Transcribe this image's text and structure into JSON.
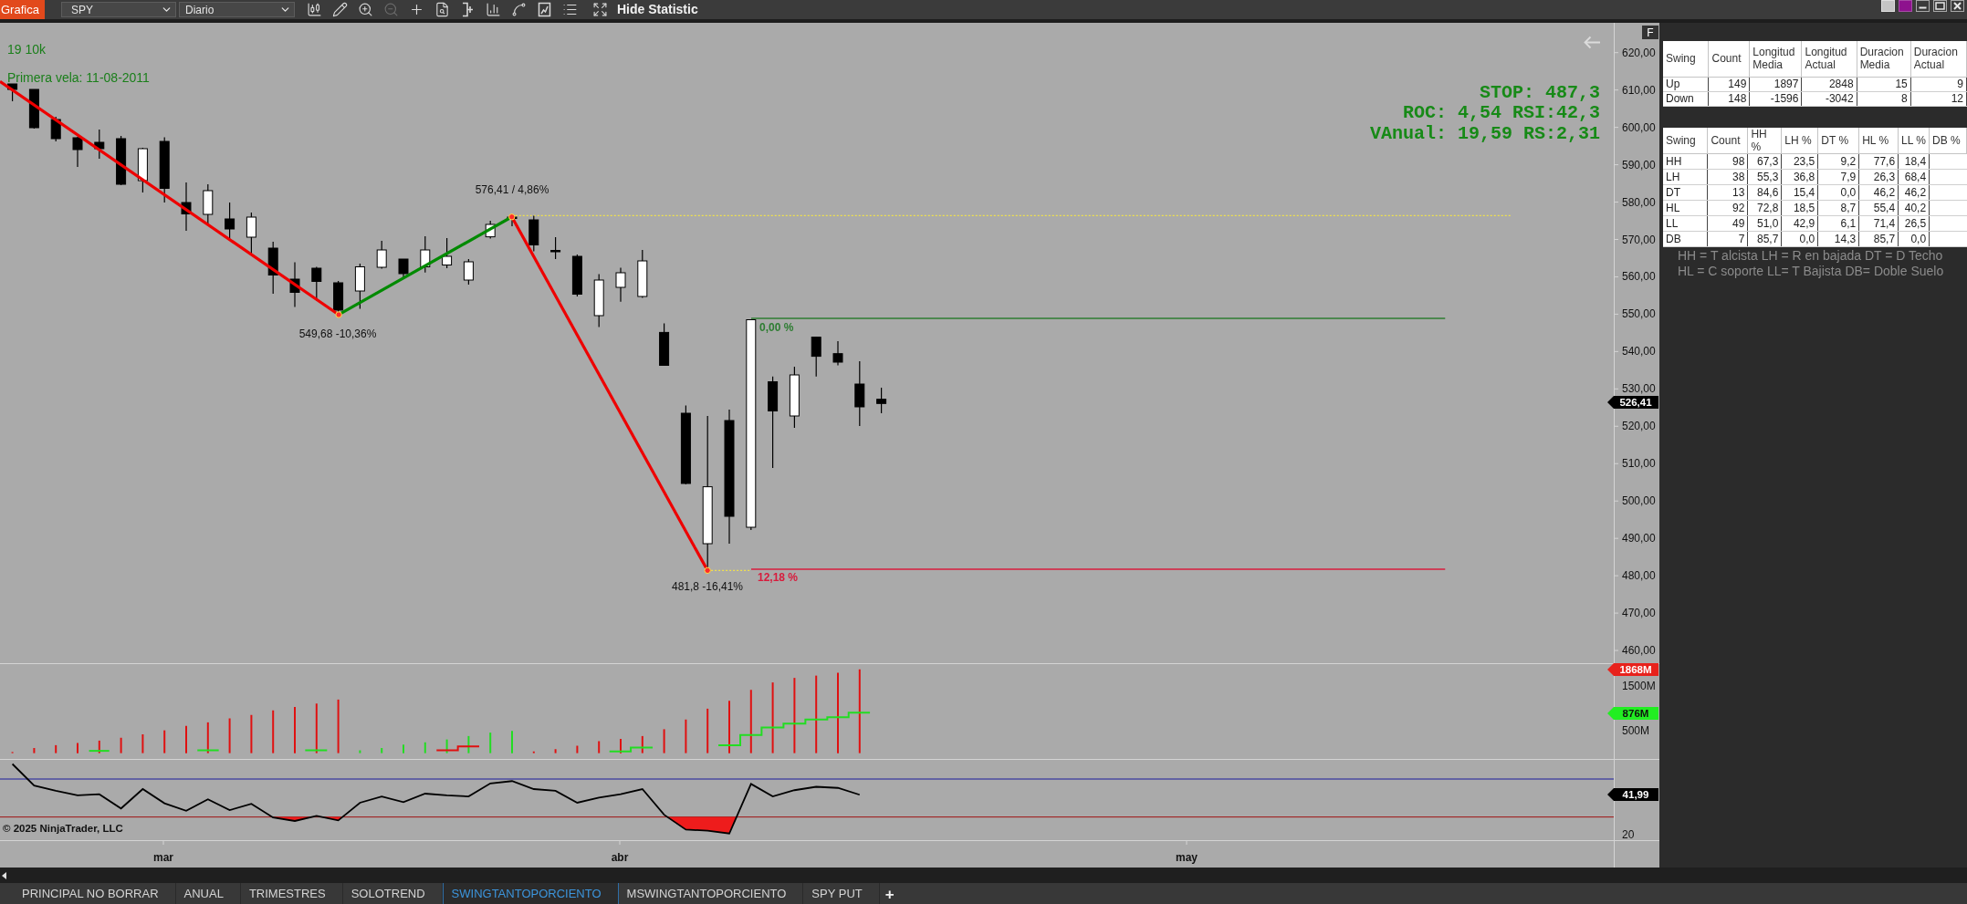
{
  "toolbar": {
    "chart_button": "Grafica",
    "instrument": "SPY",
    "period": "Diario",
    "tools": [
      {
        "kind": "candles",
        "disabled": false
      },
      {
        "kind": "draw",
        "disabled": false
      },
      {
        "kind": "zoom_in",
        "disabled": false
      },
      {
        "kind": "zoom_out",
        "disabled": true
      },
      {
        "kind": "crosshair",
        "disabled": false
      },
      {
        "kind": "data_box",
        "disabled": false
      },
      {
        "kind": "bracket",
        "disabled": false
      },
      {
        "kind": "bars",
        "disabled": false
      },
      {
        "kind": "strategy",
        "disabled": false
      },
      {
        "kind": "chart_document",
        "disabled": false
      },
      {
        "kind": "properties",
        "disabled": false
      },
      {
        "kind": "fullscreen",
        "disabled": false
      }
    ],
    "statistic_toggle": "Hide Statistic"
  },
  "chart": {
    "panel_button": "F",
    "info_lines": [
      "19 10k",
      "Primera vela: 11-08-2011"
    ],
    "stats": [
      "STOP: 487,3",
      "ROC: 4,54 RSI:42,3",
      "VAnual: 19,59 RS:2,31"
    ],
    "swing_labels": [
      "576,41 / 4,86%",
      "549,68 -10,36%",
      "481,8 -16,41%"
    ],
    "level_labels": [
      {
        "text": "0,00 %",
        "color": "#2e7d32"
      },
      {
        "text": "12,18 %",
        "color": "#d81b3c"
      }
    ],
    "price_axis": [
      "620,00",
      "610,00",
      "600,00",
      "590,00",
      "580,00",
      "570,00",
      "560,00",
      "550,00",
      "540,00",
      "530,00",
      "520,00",
      "510,00",
      "500,00",
      "490,00",
      "480,00",
      "470,00",
      "460,00"
    ],
    "price_tag": "526,41",
    "volume_axis": [
      "1500M",
      "500M"
    ],
    "volume_tags": [
      {
        "text": "1868M",
        "color": "#e8221c"
      },
      {
        "text": "876M",
        "color": "#22ee22"
      }
    ],
    "rsi_axis": [
      "20"
    ],
    "rsi_tag": "41,99",
    "copyright": "© 2025 NinjaTrader, LLC",
    "date_axis": [
      "mar",
      "abr",
      "may"
    ]
  },
  "statistics": {
    "swing_table": {
      "columns": [
        "Swing",
        "Count",
        "Longitud Media",
        "Longitud Actual",
        "Duracion Media",
        "Duracion Actual"
      ],
      "rows": [
        [
          "Up",
          "149",
          "1897",
          "2848",
          "15",
          "9"
        ],
        [
          "Down",
          "148",
          "-1596",
          "-3042",
          "8",
          "12"
        ]
      ]
    },
    "pattern_table": {
      "columns": [
        "Swing",
        "Count",
        "HH %",
        "LH %",
        "DT %",
        "HL %",
        "LL %",
        "DB %"
      ],
      "rows": [
        [
          "HH",
          "98",
          "67,3",
          "23,5",
          "9,2",
          "77,6",
          "18,4"
        ],
        [
          "LH",
          "38",
          "55,3",
          "36,8",
          "7,9",
          "26,3",
          "68,4"
        ],
        [
          "DT",
          "13",
          "84,6",
          "15,4",
          "0,0",
          "46,2",
          "46,2"
        ],
        [
          "HL",
          "92",
          "72,8",
          "18,5",
          "8,7",
          "55,4",
          "40,2"
        ],
        [
          "LL",
          "49",
          "51,0",
          "42,9",
          "6,1",
          "71,4",
          "26,5"
        ],
        [
          "DB",
          "7",
          "85,7",
          "0,0",
          "14,3",
          "85,7",
          "0,0"
        ]
      ]
    },
    "legend": [
      "HH = T alcista LH = R en bajada DT = D Techo",
      "HL = C soporte LL= T Bajista DB= Doble Suelo"
    ]
  },
  "tabs": [
    {
      "label": "PRINCIPAL NO BORRAR",
      "selected": false
    },
    {
      "label": "ANUAL",
      "selected": false
    },
    {
      "label": "TRIMESTRES",
      "selected": false
    },
    {
      "label": "SOLOTREND",
      "selected": false
    },
    {
      "label": "SWINGTANTOPORCIENTO",
      "selected": true
    },
    {
      "label": "MSWINGTANTOPORCIENTO",
      "selected": false
    },
    {
      "label": "SPY PUT",
      "selected": false
    }
  ],
  "add_tab": "+"
}
